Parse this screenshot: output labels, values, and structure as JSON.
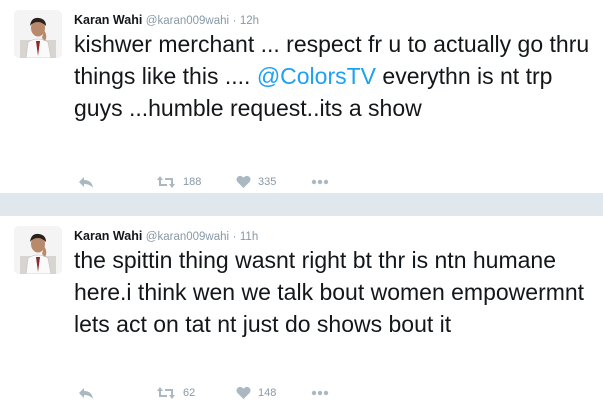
{
  "tweets": [
    {
      "name": "Karan Wahi",
      "handle": "@karan009wahi",
      "separator": "·",
      "time": "12h",
      "text_before": "kishwer merchant ... respect fr u to actually go thru things like this .... ",
      "mention": "@ColorsTV",
      "text_after": " everythn is nt trp guys ...humble request..its a show",
      "retweets": "188",
      "likes": "335"
    },
    {
      "name": "Karan Wahi",
      "handle": "@karan009wahi",
      "separator": "·",
      "time": "11h",
      "text": "the spittin thing wasnt right bt  thr is ntn humane here.i think wen we talk bout women empowermnt lets act on tat nt just do shows bout it",
      "retweets": "62",
      "likes": "148"
    }
  ],
  "colors": {
    "mention": "#1da1f2",
    "background": "#e1e8ed",
    "icon": "#aab8c2"
  },
  "icons": [
    "reply-icon",
    "retweet-icon",
    "heart-icon",
    "more-icon"
  ]
}
